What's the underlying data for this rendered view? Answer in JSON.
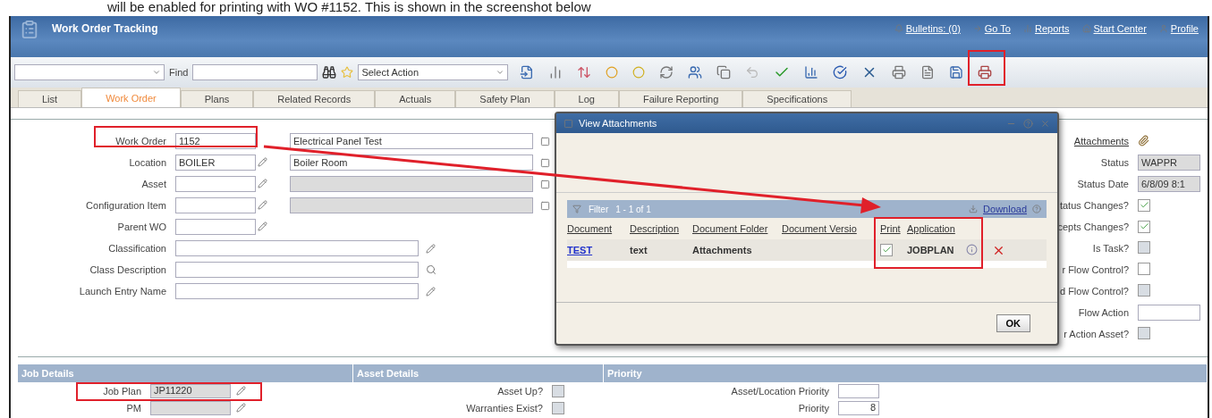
{
  "caption": "will be enabled for printing with WO #1152. This is shown in the screenshot below",
  "app": {
    "title": "Work Order Tracking",
    "header_links": [
      "Bulletins: (0)",
      "Go To",
      "Reports",
      "Start Center",
      "Profile"
    ]
  },
  "toolbar": {
    "find_label": "Find",
    "action_select": "Select Action"
  },
  "tabs": [
    {
      "label": "List",
      "selected": false
    },
    {
      "label": "Work Order",
      "selected": true
    },
    {
      "label": "Plans",
      "selected": false
    },
    {
      "label": "Related Records",
      "selected": false
    },
    {
      "label": "Actuals",
      "selected": false
    },
    {
      "label": "Safety Plan",
      "selected": false
    },
    {
      "label": "Log",
      "selected": false
    },
    {
      "label": "Failure Reporting",
      "selected": false
    },
    {
      "label": "Specifications",
      "selected": false
    }
  ],
  "fields": [
    {
      "label": "Work Order",
      "value": "1152",
      "kind": "plain_desc",
      "description": "Electrical Panel Test"
    },
    {
      "label": "Location",
      "value": "BOILER",
      "kind": "lookup_desc",
      "description": "Boiler Room"
    },
    {
      "label": "Asset",
      "kind": "lookup_desc"
    },
    {
      "label": "Configuration Item",
      "kind": "lookup_desc"
    },
    {
      "label": "Parent WO",
      "kind": "lookup"
    },
    {
      "label": "Classification",
      "kind": "wide_lookup"
    },
    {
      "label": "Class Description",
      "kind": "wide_search"
    },
    {
      "label": "Launch Entry Name",
      "kind": "wide_lookup"
    }
  ],
  "side_fields": [
    {
      "label": "Attachments",
      "kind": "link"
    },
    {
      "label": "Status",
      "kind": "text",
      "value": "WAPPR"
    },
    {
      "label": "Status Date",
      "kind": "text",
      "value": "6/8/09 8:1"
    },
    {
      "label": "tatus Changes?",
      "kind": "check",
      "checked": true,
      "disabled": false
    },
    {
      "label": "cepts Changes?",
      "kind": "check",
      "checked": true,
      "disabled": false
    },
    {
      "label": "Is Task?",
      "kind": "check",
      "checked": false,
      "disabled": true
    },
    {
      "label": "r Flow Control?",
      "kind": "check",
      "checked": false,
      "disabled": false
    },
    {
      "label": "d Flow Control?",
      "kind": "check",
      "checked": false,
      "disabled": true
    },
    {
      "label": "Flow Action",
      "kind": "input"
    },
    {
      "label": "r Action Asset?",
      "kind": "check",
      "checked": false,
      "disabled": true
    }
  ],
  "sections": [
    {
      "title": "Job Details",
      "kind": "lookup",
      "rows": [
        {
          "label": "Job Plan",
          "value": "JP11220"
        },
        {
          "label": "PM"
        }
      ]
    },
    {
      "title": "Asset Details",
      "kind": "check",
      "rows": [
        {
          "label": "Asset Up?",
          "checked": false
        },
        {
          "label": "Warranties Exist?",
          "checked": false
        }
      ]
    },
    {
      "title": "Priority",
      "kind": "small_input",
      "rows": [
        {
          "label": "Asset/Location Priority"
        },
        {
          "label": "Priority",
          "value": "8"
        }
      ]
    }
  ],
  "dialog": {
    "title": "View Attachments",
    "filter_label": "Filter",
    "pager": "1 - 1 of 1",
    "download": "Download",
    "columns": [
      "Document",
      "Description",
      "Document Folder",
      "Document Versio",
      "Print",
      "Application"
    ],
    "rows": [
      {
        "document": "TEST",
        "description": "text",
        "folder": "Attachments",
        "print": true,
        "application": "JOBPLAN"
      }
    ],
    "ok": "OK"
  }
}
